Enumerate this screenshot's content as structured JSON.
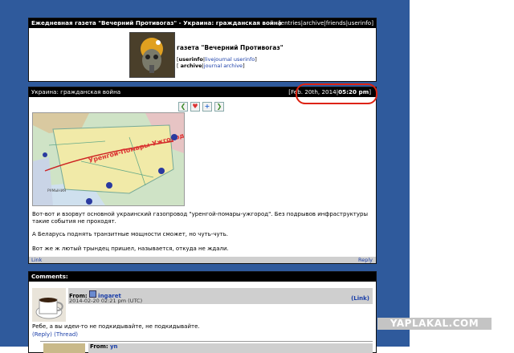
{
  "header": {
    "title": "Ежедневная газета \"Вечерний Противогаз\" - Украина: гражданская война",
    "nav": [
      "entries",
      "archive",
      "friends",
      "userinfo"
    ],
    "journal_name": "газета \"Вечерний Противогаз\"",
    "userinfo_label": "userinfo",
    "userinfo_link": "livejournal userinfo",
    "archive_label": "archive",
    "archive_link": "journal archive"
  },
  "post": {
    "subject": "Украина: гражданская война",
    "date": "Feb. 20th, 2014",
    "time": "05:20 pm",
    "map_label": "Уренгой-Помары-Ужгород",
    "map_country": "РУМЫНИЯ",
    "paragraph1": "Вот-вот и взорвут основной украинский газопровод \"уренгой-помары-ужгород\". Без подрывов инфраструктуры такие события не проходят.",
    "paragraph2": "А Беларусь поднять транзитные мощности сможет, но чуть-чуть.",
    "paragraph3": "Вот же ж лютый трындец пришел, называется, откуда не ждали.",
    "link_label": "Link",
    "reply_label": "Reply"
  },
  "comments": {
    "title": "Comments:",
    "items": [
      {
        "from_label": "From:",
        "user": "ingaret",
        "timestamp": "2014-02-20 02:21 pm (UTC)",
        "link_label": "(Link)",
        "text": "Ребе, а вы идеи-то не подкидывайте, не подкидывайте.",
        "reply": "(Reply)",
        "thread": "(Thread)"
      },
      {
        "from_label": "From:",
        "user": "yn"
      }
    ]
  },
  "watermark": "YAPLAKAL.COM",
  "colors": {
    "bg_blue": "#2f5a9c",
    "link": "#1a3ea8",
    "bar": "#000000",
    "highlight": "#d21111"
  }
}
